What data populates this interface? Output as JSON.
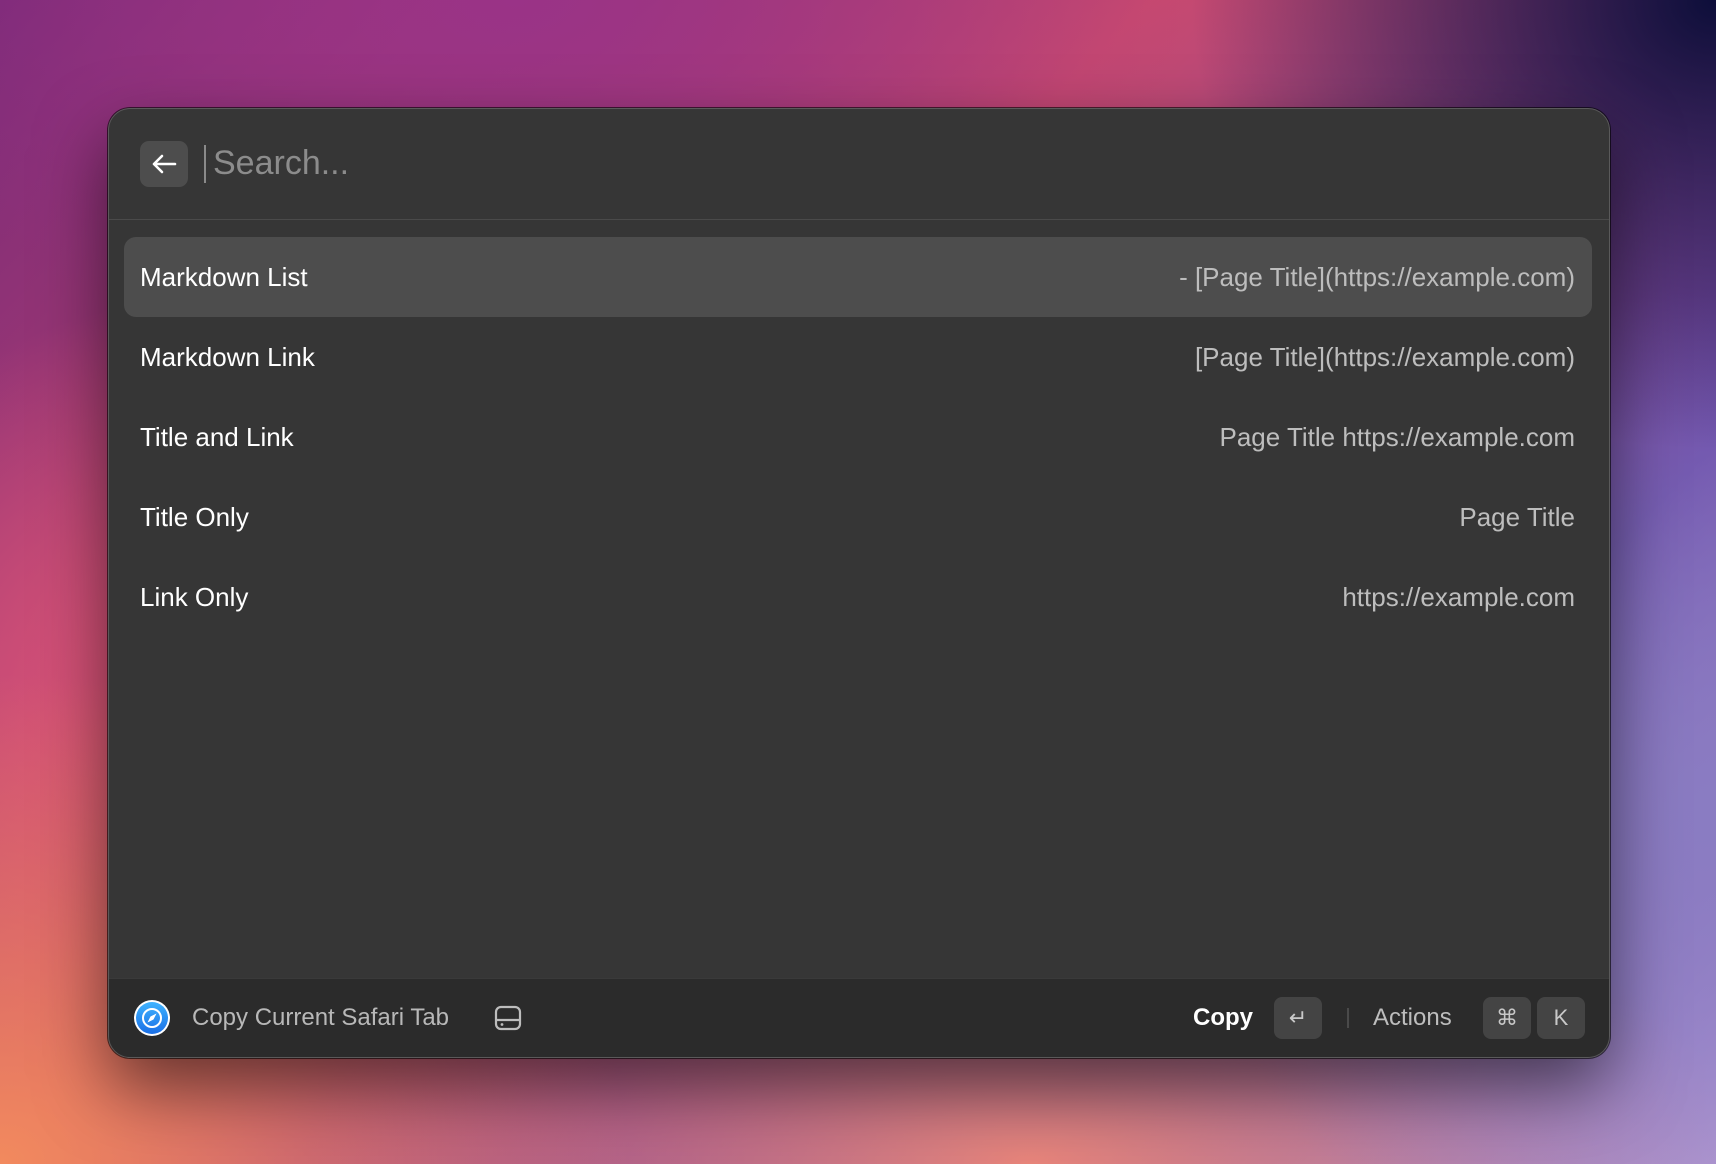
{
  "search": {
    "placeholder": "Search...",
    "value": ""
  },
  "items": [
    {
      "title": "Markdown List",
      "preview": "- [Page Title](https://example.com)",
      "selected": true
    },
    {
      "title": "Markdown Link",
      "preview": "[Page Title](https://example.com)",
      "selected": false
    },
    {
      "title": "Title and Link",
      "preview": "Page Title https://example.com",
      "selected": false
    },
    {
      "title": "Title Only",
      "preview": "Page Title",
      "selected": false
    },
    {
      "title": "Link Only",
      "preview": "https://example.com",
      "selected": false
    }
  ],
  "footer": {
    "command_title": "Copy Current Safari Tab",
    "primary_action": "Copy",
    "primary_shortcut": "↵",
    "actions_label": "Actions",
    "actions_shortcut_modifier": "⌘",
    "actions_shortcut_key": "K"
  },
  "icons": {
    "back": "arrow-left-icon",
    "command": "safari-compass-icon",
    "extension": "drive-icon"
  },
  "colors": {
    "window_bg": "#363636",
    "selected_row": "#4d4d4d",
    "footer_bg": "#2b2b2b",
    "safari_blue": "#1e8ef5"
  }
}
